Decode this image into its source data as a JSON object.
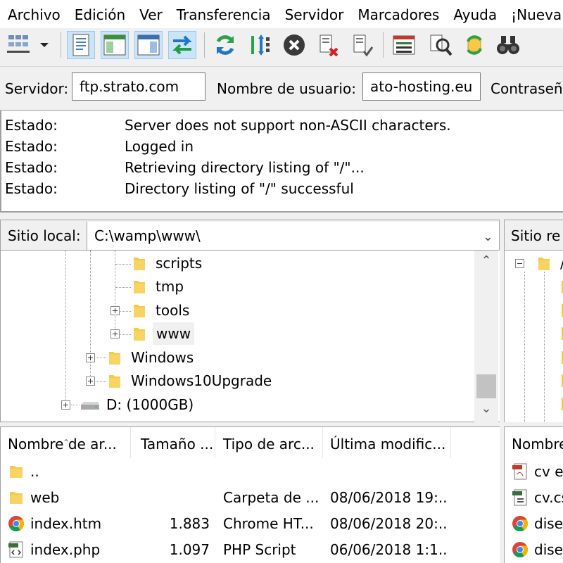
{
  "menu": [
    "Archivo",
    "Edición",
    "Ver",
    "Transferencia",
    "Servidor",
    "Marcadores",
    "Ayuda",
    "¡Nueva"
  ],
  "quickconnect": {
    "host_label": "Servidor:",
    "host_value": "ftp.strato.com",
    "user_label": "Nombre de usuario:",
    "user_value": "ato-hosting.eu",
    "pass_label": "Contraseña"
  },
  "log": [
    {
      "key": "Estado:",
      "value": "Server does not support non-ASCII characters."
    },
    {
      "key": "Estado:",
      "value": "Logged in"
    },
    {
      "key": "Estado:",
      "value": "Retrieving directory listing of \"/\"..."
    },
    {
      "key": "Estado:",
      "value": "Directory listing of \"/\" successful"
    }
  ],
  "local": {
    "label": "Sitio local:",
    "path": "C:\\wamp\\www\\",
    "tree": [
      "scripts",
      "tmp",
      "tools",
      "www",
      "Windows",
      "Windows10Upgrade",
      "D: (1000GB)"
    ]
  },
  "remote": {
    "label": "Sitio re",
    "tree_root": "/",
    "list_header": "Nombre",
    "files": [
      "cv en",
      "cv.cs",
      "dise",
      "dise"
    ]
  },
  "filelist": {
    "columns": [
      "Nombre de ar...",
      "Tamaño ...",
      "Tipo de arc...",
      "Última modific..."
    ],
    "rows": [
      {
        "name": "..",
        "size": "",
        "type": "",
        "modified": "",
        "icon": "folder-icon"
      },
      {
        "name": "web",
        "size": "",
        "type": "Carpeta de ...",
        "modified": "08/06/2018 19:...",
        "icon": "folder-icon"
      },
      {
        "name": "index.htm",
        "size": "1.883",
        "type": "Chrome HT...",
        "modified": "08/06/2018 20:...",
        "icon": "chrome-icon"
      },
      {
        "name": "index.php",
        "size": "1.097",
        "type": "PHP Script",
        "modified": "06/06/2018 1:1...",
        "icon": "php-file-icon"
      }
    ]
  },
  "colors": {
    "folder": "#f7c948",
    "active_button": "#cce4f7",
    "refresh_green": "#2aa24a",
    "cancel_dark": "#3a3a3a"
  }
}
